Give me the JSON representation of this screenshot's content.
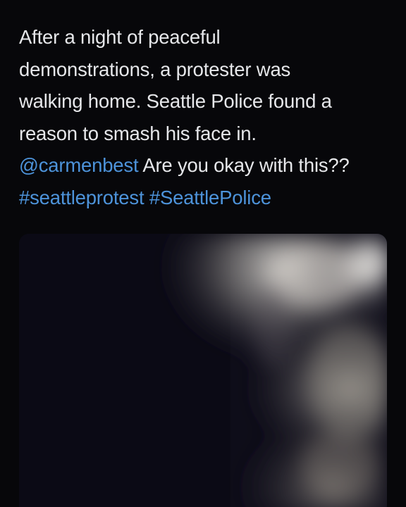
{
  "tweet": {
    "text_lines": {
      "line1": "After a night of peaceful",
      "line2": "demonstrations, a protester was",
      "line3": "walking home. Seattle Police found a",
      "line4": "reason to smash his face in."
    },
    "mention": "@carmenbest",
    "after_mention": " Are you okay with this??",
    "hashtags": {
      "first": "#seattleprotest",
      "second": "#SeattlePolice"
    },
    "media": {
      "kind": "video-still"
    }
  },
  "colors": {
    "background": "#07070a",
    "text": "#e6e7ea",
    "link": "#4d93da"
  }
}
